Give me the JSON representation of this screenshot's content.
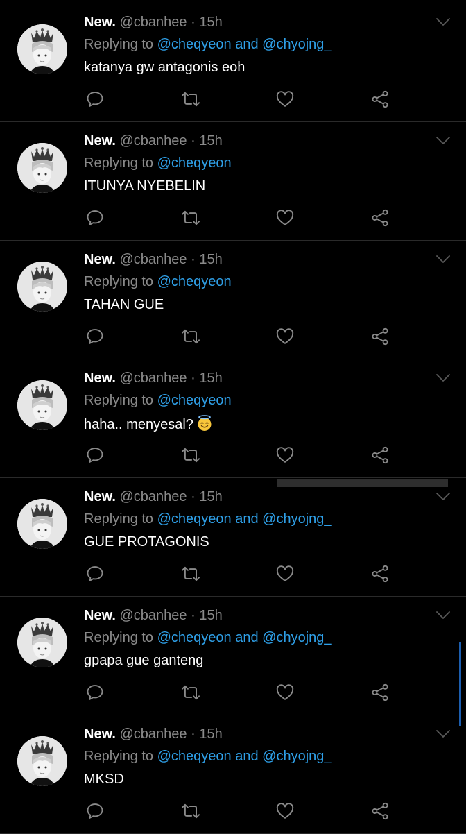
{
  "colors": {
    "background": "#000000",
    "text": "#ffffff",
    "muted": "#8a8a8a",
    "accent": "#2fa0e8",
    "divider": "#2a2a2a"
  },
  "icons": {
    "reply": "comment-bubble-icon",
    "retweet": "retweet-icon",
    "like": "heart-icon",
    "share": "share-icon",
    "more": "chevron-down-icon"
  },
  "tweets": [
    {
      "name": "New.",
      "handle": "@cbanhee",
      "dot": "·",
      "time": "15h",
      "replying_prefix": "Replying to",
      "mentions": [
        "@cheqyeon",
        "@chyojng_"
      ],
      "and": "and",
      "text": "katanya gw antagonis eoh"
    },
    {
      "name": "New.",
      "handle": "@cbanhee",
      "dot": "·",
      "time": "15h",
      "replying_prefix": "Replying to",
      "mentions": [
        "@cheqyeon"
      ],
      "text": "ITUNYA NYEBELIN"
    },
    {
      "name": "New.",
      "handle": "@cbanhee",
      "dot": "·",
      "time": "15h",
      "replying_prefix": "Replying to",
      "mentions": [
        "@cheqyeon"
      ],
      "text": "TAHAN GUE"
    },
    {
      "name": "New.",
      "handle": "@cbanhee",
      "dot": "·",
      "time": "15h",
      "replying_prefix": "Replying to",
      "mentions": [
        "@cheqyeon"
      ],
      "text": "haha.. menyesal?",
      "emoji": "smiling-face-with-halo"
    },
    {
      "name": "New.",
      "handle": "@cbanhee",
      "dot": "·",
      "time": "15h",
      "replying_prefix": "Replying to",
      "mentions": [
        "@cheqyeon",
        "@chyojng_"
      ],
      "and": "and",
      "text": "GUE PROTAGONIS"
    },
    {
      "name": "New.",
      "handle": "@cbanhee",
      "dot": "·",
      "time": "15h",
      "replying_prefix": "Replying to",
      "mentions": [
        "@cheqyeon",
        "@chyojng_"
      ],
      "and": "and",
      "text": "gpapa gue ganteng"
    },
    {
      "name": "New.",
      "handle": "@cbanhee",
      "dot": "·",
      "time": "15h",
      "replying_prefix": "Replying to",
      "mentions": [
        "@cheqyeon",
        "@chyojng_"
      ],
      "and": "and",
      "text": "MKSD"
    }
  ]
}
